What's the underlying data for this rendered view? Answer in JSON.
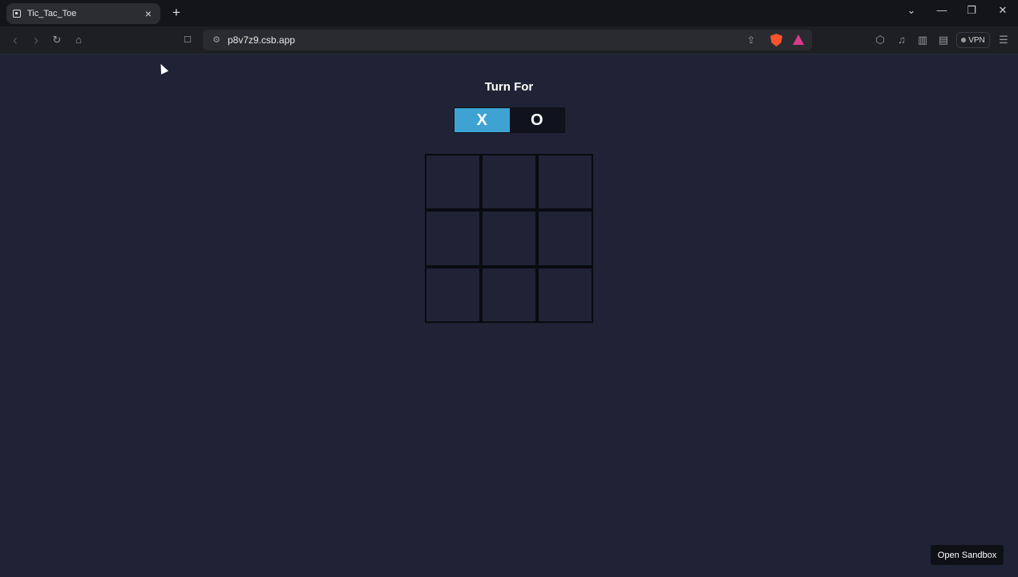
{
  "browser": {
    "tab": {
      "title": "Tic_Tac_Toe",
      "close_label": "×"
    },
    "new_tab_label": "+",
    "window_controls": {
      "tabs_dropdown": "⌄",
      "minimize": "—",
      "restore": "❐",
      "close": "✕"
    },
    "toolbar": {
      "back": "‹",
      "forward": "›",
      "reload": "↻",
      "home": "⌂",
      "bookmark": "☐",
      "url": "p8v7z9.csb.app",
      "vpn_label": "VPN"
    }
  },
  "game": {
    "turn_label": "Turn For",
    "players": [
      {
        "symbol": "X",
        "active": true
      },
      {
        "symbol": "O",
        "active": false
      }
    ],
    "board": [
      "",
      "",
      "",
      "",
      "",
      "",
      "",
      "",
      ""
    ]
  },
  "footer": {
    "open_sandbox_label": "Open Sandbox"
  },
  "colors": {
    "background": "#1f2335",
    "active_turn": "#3ea3d2",
    "grid_line": "#0a0b10"
  }
}
